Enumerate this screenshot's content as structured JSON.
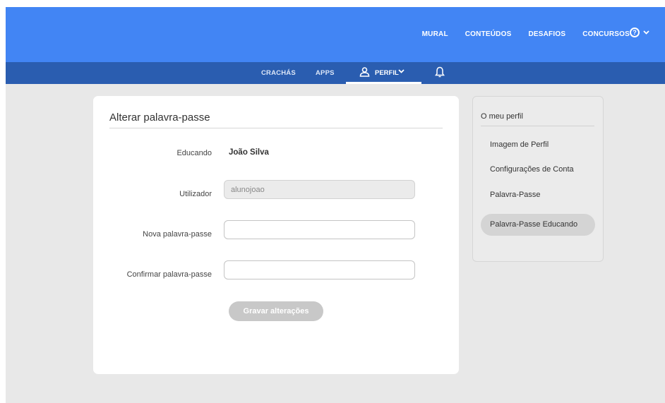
{
  "topnav": {
    "mural": "MURAL",
    "conteudos": "CONTEÚDOS",
    "desafios": "DESAFIOS",
    "concursos": "CONCURSOS",
    "help_icon": "?",
    "help_chevron": "⌄"
  },
  "subnav": {
    "crachas": "CRACHÁS",
    "apps": "APPS",
    "perfil": "PERFIL",
    "perfil_chevron": "⌄"
  },
  "form": {
    "title": "Alterar palavra-passe",
    "educando_label": "Educando",
    "educando_value": "João Silva",
    "utilizador_label": "Utilizador",
    "utilizador_value": "alunojoao",
    "nova_label": "Nova palavra-passe",
    "nova_value": "",
    "confirmar_label": "Confirmar palavra-passe",
    "confirmar_value": "",
    "save_label": "Gravar alterações"
  },
  "sidebar": {
    "title": "O meu perfil",
    "items": [
      {
        "label": "Imagem de Perfil"
      },
      {
        "label": "Configurações de Conta"
      },
      {
        "label": "Palavra-Passe"
      },
      {
        "label": "Palavra-Passe Educando",
        "active": true
      }
    ]
  },
  "colors": {
    "topbar": "#4285f4",
    "subbar": "#2a5db0",
    "background": "#e8e8e8",
    "button_disabled": "#c8c8c8"
  }
}
